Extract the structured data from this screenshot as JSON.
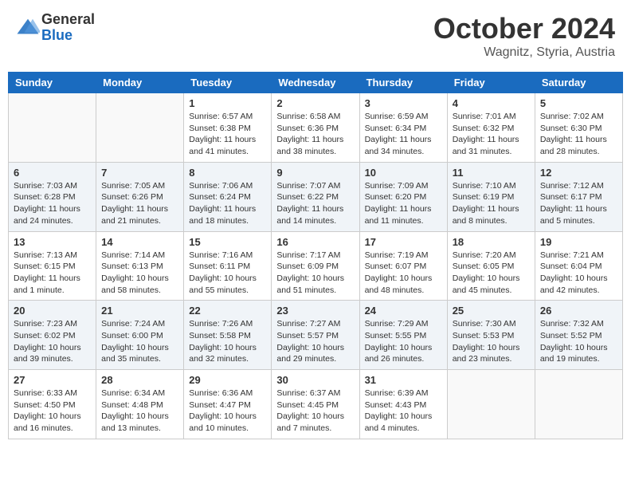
{
  "header": {
    "logo": {
      "general": "General",
      "blue": "Blue"
    },
    "title": "October 2024",
    "location": "Wagnitz, Styria, Austria"
  },
  "weekdays": [
    "Sunday",
    "Monday",
    "Tuesday",
    "Wednesday",
    "Thursday",
    "Friday",
    "Saturday"
  ],
  "weeks": [
    [
      {
        "day": "",
        "info": ""
      },
      {
        "day": "",
        "info": ""
      },
      {
        "day": "1",
        "info": "Sunrise: 6:57 AM\nSunset: 6:38 PM\nDaylight: 11 hours and 41 minutes."
      },
      {
        "day": "2",
        "info": "Sunrise: 6:58 AM\nSunset: 6:36 PM\nDaylight: 11 hours and 38 minutes."
      },
      {
        "day": "3",
        "info": "Sunrise: 6:59 AM\nSunset: 6:34 PM\nDaylight: 11 hours and 34 minutes."
      },
      {
        "day": "4",
        "info": "Sunrise: 7:01 AM\nSunset: 6:32 PM\nDaylight: 11 hours and 31 minutes."
      },
      {
        "day": "5",
        "info": "Sunrise: 7:02 AM\nSunset: 6:30 PM\nDaylight: 11 hours and 28 minutes."
      }
    ],
    [
      {
        "day": "6",
        "info": "Sunrise: 7:03 AM\nSunset: 6:28 PM\nDaylight: 11 hours and 24 minutes."
      },
      {
        "day": "7",
        "info": "Sunrise: 7:05 AM\nSunset: 6:26 PM\nDaylight: 11 hours and 21 minutes."
      },
      {
        "day": "8",
        "info": "Sunrise: 7:06 AM\nSunset: 6:24 PM\nDaylight: 11 hours and 18 minutes."
      },
      {
        "day": "9",
        "info": "Sunrise: 7:07 AM\nSunset: 6:22 PM\nDaylight: 11 hours and 14 minutes."
      },
      {
        "day": "10",
        "info": "Sunrise: 7:09 AM\nSunset: 6:20 PM\nDaylight: 11 hours and 11 minutes."
      },
      {
        "day": "11",
        "info": "Sunrise: 7:10 AM\nSunset: 6:19 PM\nDaylight: 11 hours and 8 minutes."
      },
      {
        "day": "12",
        "info": "Sunrise: 7:12 AM\nSunset: 6:17 PM\nDaylight: 11 hours and 5 minutes."
      }
    ],
    [
      {
        "day": "13",
        "info": "Sunrise: 7:13 AM\nSunset: 6:15 PM\nDaylight: 11 hours and 1 minute."
      },
      {
        "day": "14",
        "info": "Sunrise: 7:14 AM\nSunset: 6:13 PM\nDaylight: 10 hours and 58 minutes."
      },
      {
        "day": "15",
        "info": "Sunrise: 7:16 AM\nSunset: 6:11 PM\nDaylight: 10 hours and 55 minutes."
      },
      {
        "day": "16",
        "info": "Sunrise: 7:17 AM\nSunset: 6:09 PM\nDaylight: 10 hours and 51 minutes."
      },
      {
        "day": "17",
        "info": "Sunrise: 7:19 AM\nSunset: 6:07 PM\nDaylight: 10 hours and 48 minutes."
      },
      {
        "day": "18",
        "info": "Sunrise: 7:20 AM\nSunset: 6:05 PM\nDaylight: 10 hours and 45 minutes."
      },
      {
        "day": "19",
        "info": "Sunrise: 7:21 AM\nSunset: 6:04 PM\nDaylight: 10 hours and 42 minutes."
      }
    ],
    [
      {
        "day": "20",
        "info": "Sunrise: 7:23 AM\nSunset: 6:02 PM\nDaylight: 10 hours and 39 minutes."
      },
      {
        "day": "21",
        "info": "Sunrise: 7:24 AM\nSunset: 6:00 PM\nDaylight: 10 hours and 35 minutes."
      },
      {
        "day": "22",
        "info": "Sunrise: 7:26 AM\nSunset: 5:58 PM\nDaylight: 10 hours and 32 minutes."
      },
      {
        "day": "23",
        "info": "Sunrise: 7:27 AM\nSunset: 5:57 PM\nDaylight: 10 hours and 29 minutes."
      },
      {
        "day": "24",
        "info": "Sunrise: 7:29 AM\nSunset: 5:55 PM\nDaylight: 10 hours and 26 minutes."
      },
      {
        "day": "25",
        "info": "Sunrise: 7:30 AM\nSunset: 5:53 PM\nDaylight: 10 hours and 23 minutes."
      },
      {
        "day": "26",
        "info": "Sunrise: 7:32 AM\nSunset: 5:52 PM\nDaylight: 10 hours and 19 minutes."
      }
    ],
    [
      {
        "day": "27",
        "info": "Sunrise: 6:33 AM\nSunset: 4:50 PM\nDaylight: 10 hours and 16 minutes."
      },
      {
        "day": "28",
        "info": "Sunrise: 6:34 AM\nSunset: 4:48 PM\nDaylight: 10 hours and 13 minutes."
      },
      {
        "day": "29",
        "info": "Sunrise: 6:36 AM\nSunset: 4:47 PM\nDaylight: 10 hours and 10 minutes."
      },
      {
        "day": "30",
        "info": "Sunrise: 6:37 AM\nSunset: 4:45 PM\nDaylight: 10 hours and 7 minutes."
      },
      {
        "day": "31",
        "info": "Sunrise: 6:39 AM\nSunset: 4:43 PM\nDaylight: 10 hours and 4 minutes."
      },
      {
        "day": "",
        "info": ""
      },
      {
        "day": "",
        "info": ""
      }
    ]
  ]
}
